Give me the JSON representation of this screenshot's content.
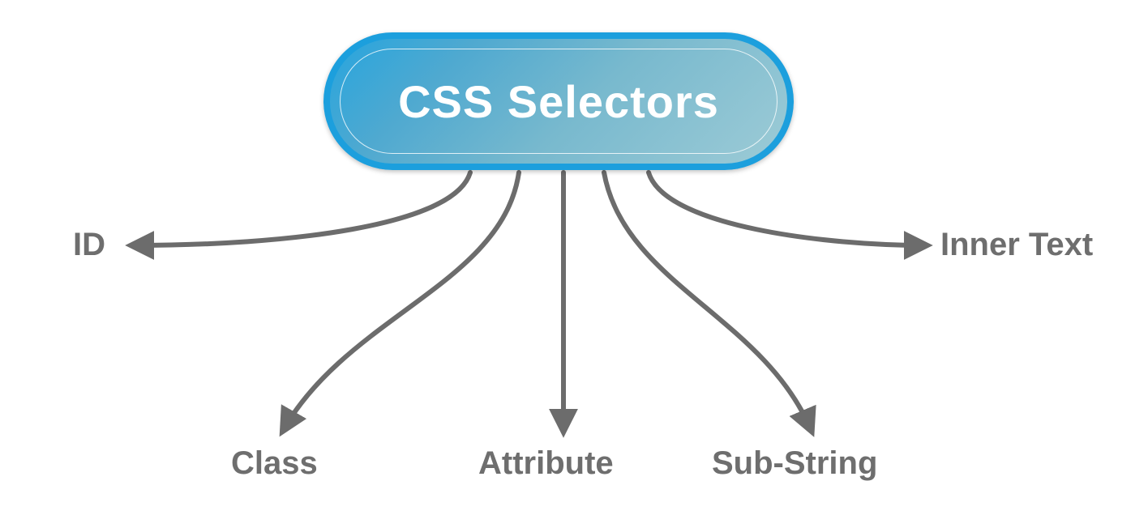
{
  "root": {
    "title": "CSS Selectors"
  },
  "branches": {
    "id": "ID",
    "class": "Class",
    "attribute": "Attribute",
    "substring": "Sub-String",
    "innertext": "Inner Text"
  },
  "colors": {
    "connector": "#6C6C6C",
    "label": "#6E6E6E",
    "pillBorder": "#1C9FDD"
  }
}
